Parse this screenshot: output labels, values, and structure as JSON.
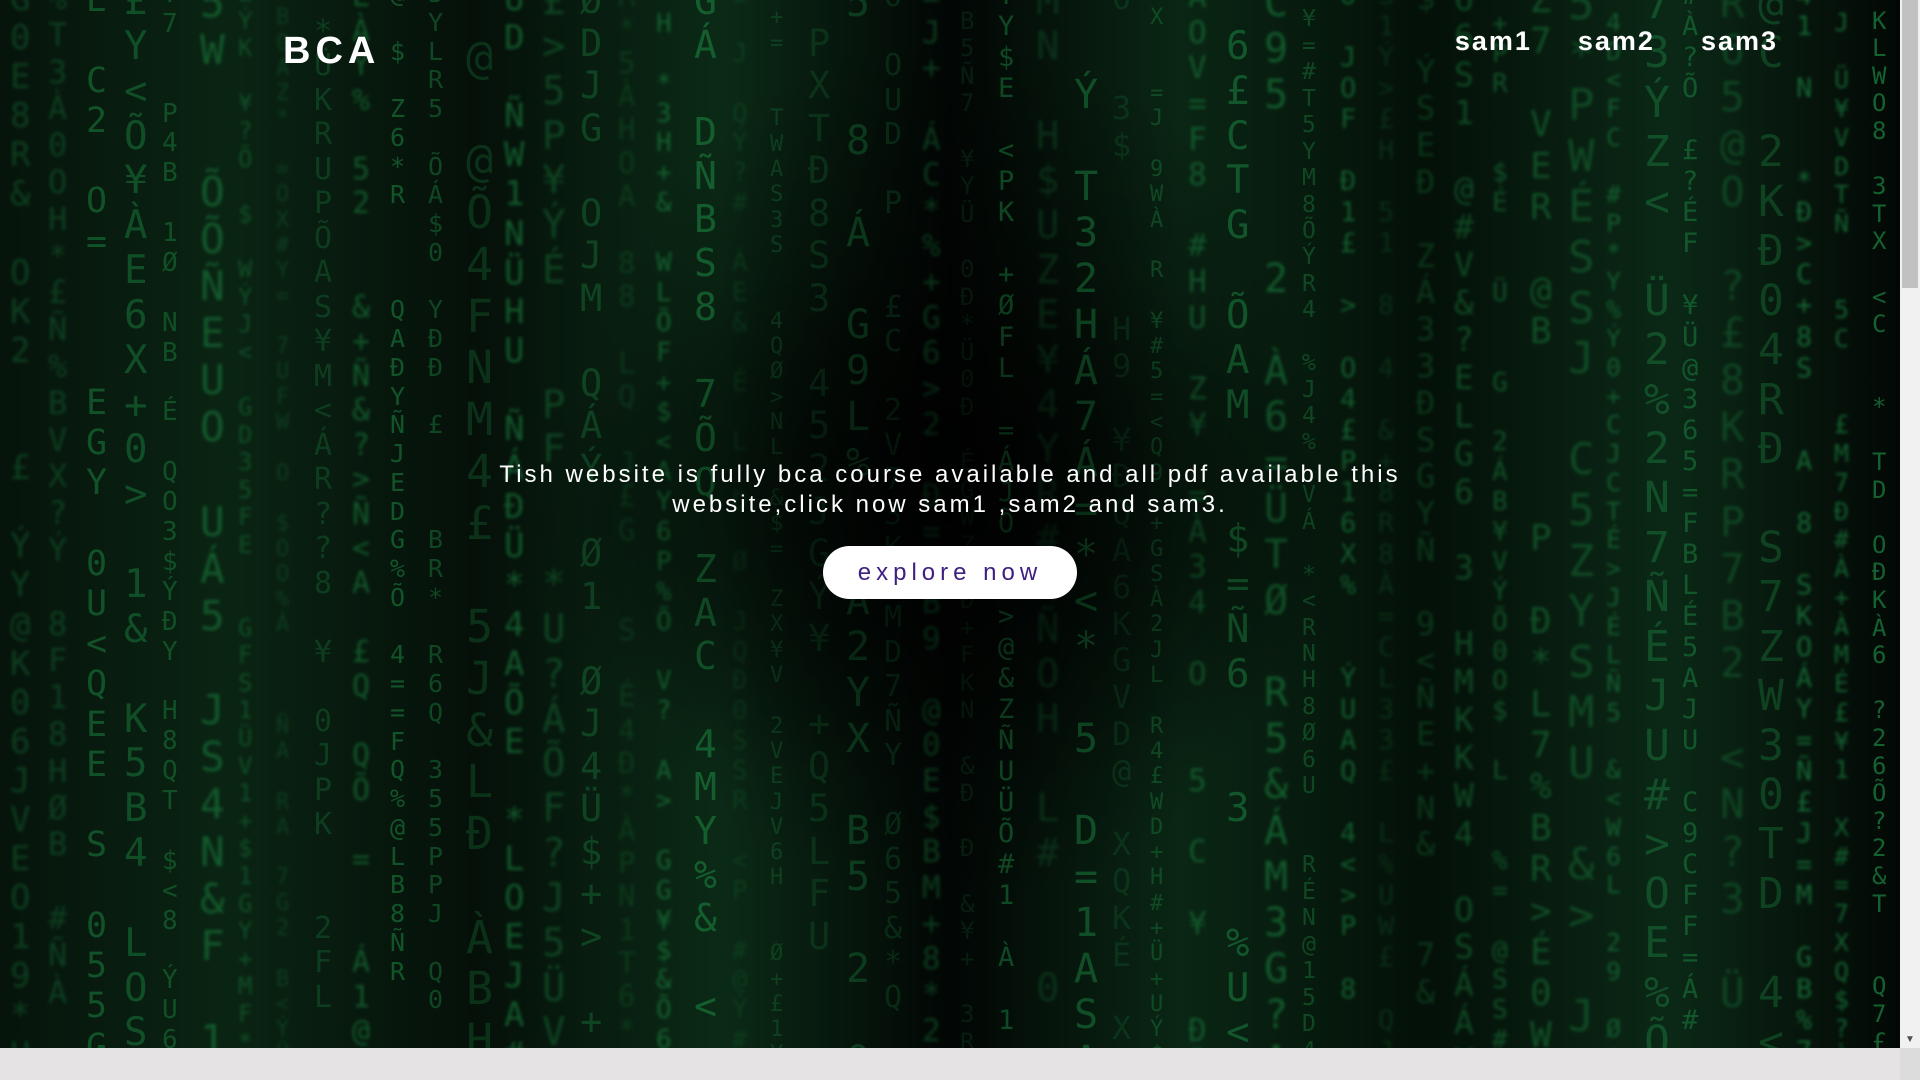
{
  "navbar": {
    "logo": "BCA",
    "links": [
      "sam1",
      "sam2",
      "sam3"
    ]
  },
  "hero": {
    "text": "Tish website is fully bca course available and all pdf available this website,click now sam1 ,sam2 and sam3.",
    "button_label": "explore now"
  },
  "colors": {
    "background": "#020603",
    "matrix_green": "#1f9b4c",
    "text": "#ffffff",
    "button_bg": "#ffffff",
    "button_text": "#3d1f80"
  },
  "icons": {
    "scroll_up": "triangle-up",
    "scroll_down": "triangle-down"
  }
}
